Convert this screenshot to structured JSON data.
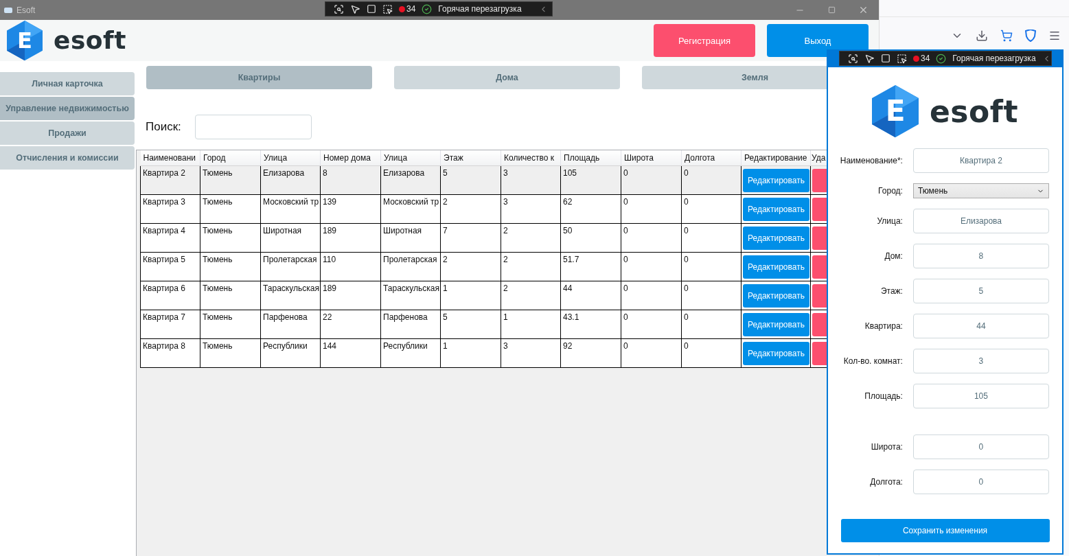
{
  "main_window": {
    "title": "Esoft",
    "debug_toolbar": {
      "count": "34",
      "status": "Горячая перезагрузка"
    },
    "logo": {
      "mark": "E",
      "name": "esoft"
    },
    "header_buttons": [
      {
        "label": "Регистрация",
        "kind": "danger"
      },
      {
        "label": "Выход",
        "kind": "primary"
      }
    ],
    "sidebar": {
      "items": [
        {
          "label": "Личная карточка",
          "selected": false
        },
        {
          "label": "Управление недвижимостью",
          "selected": true
        },
        {
          "label": "Продажи",
          "selected": false
        },
        {
          "label": "Отчисления и комиссии",
          "selected": false
        }
      ]
    },
    "tabs": [
      {
        "label": "Квартиры",
        "selected": true
      },
      {
        "label": "Дома",
        "selected": false
      },
      {
        "label": "Земля",
        "selected": false
      }
    ],
    "search": {
      "label": "Поиск:"
    },
    "table": {
      "columns": [
        "Наименовани",
        "Город",
        "Улица",
        "Номер дома",
        "Улица",
        "Этаж",
        "Количество к",
        "Площадь",
        "Широта",
        "Долгота",
        "Редактирование",
        "Уда"
      ],
      "rows": [
        {
          "cells": [
            "Квартира 2",
            "Тюмень",
            "Елизарова",
            "8",
            "Елизарова",
            "5",
            "3",
            "105",
            "0",
            "0"
          ],
          "edit_button": "Редактировать",
          "selected": true
        },
        {
          "cells": [
            "Квартира 3",
            "Тюмень",
            "Московский тр",
            "139",
            "Московский тр",
            "2",
            "3",
            "62",
            "0",
            "0"
          ],
          "edit_button": "Редактировать",
          "selected": false
        },
        {
          "cells": [
            "Квартира 4",
            "Тюмень",
            "Широтная",
            "189",
            "Широтная",
            "7",
            "2",
            "50",
            "0",
            "0"
          ],
          "edit_button": "Редактировать",
          "selected": false
        },
        {
          "cells": [
            "Квартира 5",
            "Тюмень",
            "Пролетарская",
            "110",
            "Пролетарская",
            "2",
            "2",
            "51.7",
            "0",
            "0"
          ],
          "edit_button": "Редактировать",
          "selected": false
        },
        {
          "cells": [
            "Квартира 6",
            "Тюмень",
            "Тараскульская",
            "189",
            "Тараскульская",
            "1",
            "2",
            "44",
            "0",
            "0"
          ],
          "edit_button": "Редактировать",
          "selected": false
        },
        {
          "cells": [
            "Квартира 7",
            "Тюмень",
            "Парфенова",
            "22",
            "Парфенова",
            "5",
            "1",
            "43.1",
            "0",
            "0"
          ],
          "edit_button": "Редактировать",
          "selected": false
        },
        {
          "cells": [
            "Квартира 8",
            "Тюмень",
            "Республики",
            "144",
            "Республики",
            "1",
            "3",
            "92",
            "0",
            "0"
          ],
          "edit_button": "Редактировать",
          "selected": false
        }
      ]
    }
  },
  "dialog": {
    "debug_toolbar": {
      "count": "34",
      "status": "Горячая перезагрузка"
    },
    "logo": {
      "mark": "E",
      "name": "esoft"
    },
    "fields": [
      {
        "label": "Наименование*:",
        "value": "Квартира 2",
        "kind": "text"
      },
      {
        "label": "Город:",
        "value": "Тюмень",
        "kind": "select"
      },
      {
        "label": "Улица:",
        "value": "Елизарова",
        "kind": "text"
      },
      {
        "label": "Дом:",
        "value": "8",
        "kind": "text"
      },
      {
        "label": "Этаж:",
        "value": "5",
        "kind": "text"
      },
      {
        "label": "Квартира:",
        "value": "44",
        "kind": "text"
      },
      {
        "label": "Кол-во. комнат:",
        "value": "3",
        "kind": "text"
      },
      {
        "label": "Площадь:",
        "value": "105",
        "kind": "text"
      }
    ],
    "coordinate_fields": [
      {
        "label": "Широта:",
        "value": "0",
        "kind": "text"
      },
      {
        "label": "Долгота:",
        "value": "0",
        "kind": "text"
      }
    ],
    "save_button": "Сохранить изменения"
  }
}
